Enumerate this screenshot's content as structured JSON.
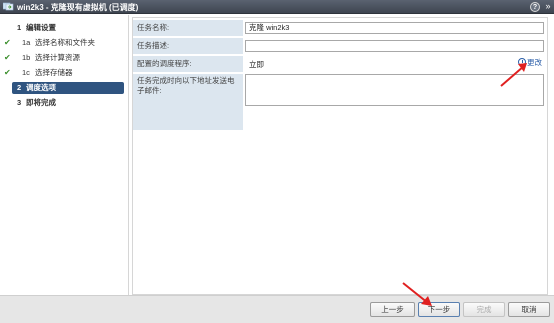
{
  "window": {
    "title": "win2k3 - 克隆现有虚拟机 (已调度)",
    "help_symbol": "?",
    "expand_symbol": "»"
  },
  "nav": {
    "items": [
      {
        "num": "1",
        "label": "编辑设置",
        "checked": false,
        "active": false,
        "bold": true
      },
      {
        "num": "1a",
        "label": "选择名称和文件夹",
        "checked": true,
        "active": false,
        "bold": false
      },
      {
        "num": "1b",
        "label": "选择计算资源",
        "checked": true,
        "active": false,
        "bold": false
      },
      {
        "num": "1c",
        "label": "选择存储器",
        "checked": true,
        "active": false,
        "bold": false
      },
      {
        "num": "2",
        "label": "调度选项",
        "checked": false,
        "active": true,
        "bold": true
      },
      {
        "num": "3",
        "label": "即将完成",
        "checked": false,
        "active": false,
        "bold": true
      }
    ],
    "check_glyph": "✔"
  },
  "form": {
    "task_name_label": "任务名称:",
    "task_name_value": "克隆 win2k3",
    "task_desc_label": "任务描述:",
    "task_desc_value": "",
    "scheduler_label": "配置的调度程序:",
    "scheduler_value": "立即",
    "change_link": "更改",
    "email_label": "任务完成时向以下地址发送电子邮件:",
    "email_value": ""
  },
  "footer": {
    "back": "上一步",
    "next": "下一步",
    "finish": "完成",
    "cancel": "取消"
  },
  "colors": {
    "active_nav": "#2f5480",
    "label_bg": "#dce6ef",
    "annotation": "#e02020"
  }
}
